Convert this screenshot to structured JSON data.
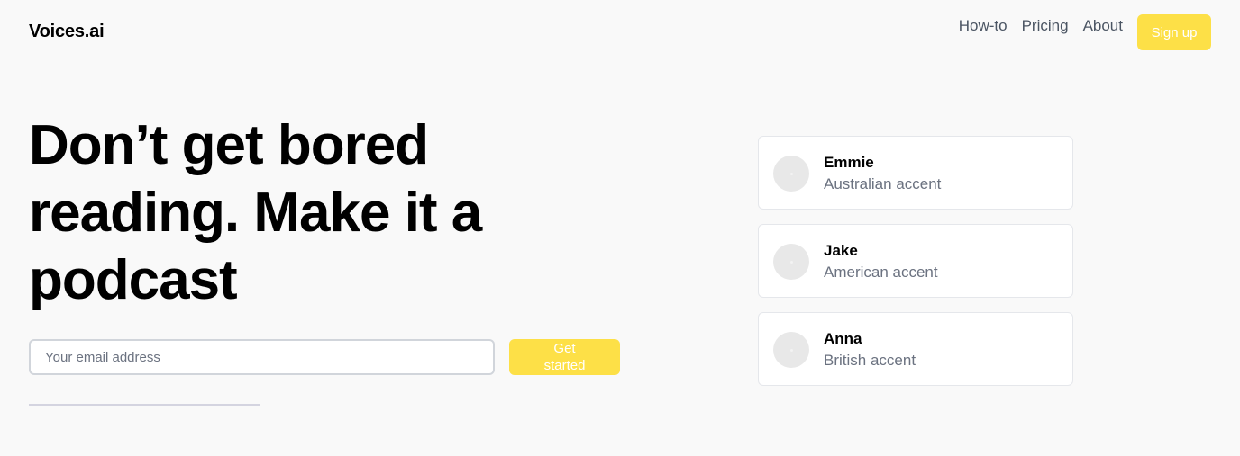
{
  "header": {
    "logo": "Voices.ai",
    "nav": [
      "How-to",
      "Pricing",
      "About"
    ],
    "signup_label": "Sign up"
  },
  "hero": {
    "headline": "Don’t get bored reading. Make it a podcast",
    "email_placeholder": "Your email address",
    "cta_label": "Get started"
  },
  "voices": [
    {
      "name": "Emmie",
      "accent": "Australian accent"
    },
    {
      "name": "Jake",
      "accent": "American accent"
    },
    {
      "name": "Anna",
      "accent": "British accent"
    }
  ],
  "colors": {
    "accent": "#fde047",
    "background": "#f9f9f9",
    "muted_text": "#6b7280"
  }
}
